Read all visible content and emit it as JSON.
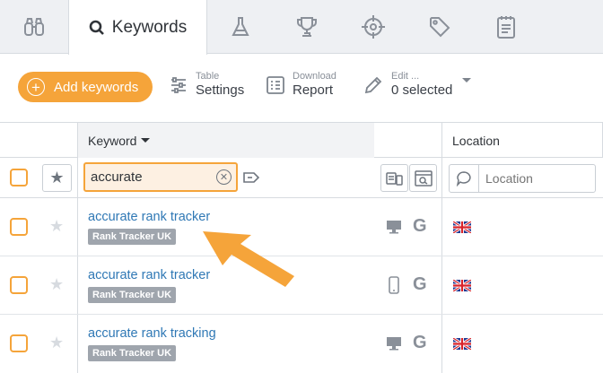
{
  "tabs": {
    "active_label": "Keywords"
  },
  "toolbar": {
    "add_label": "Add keywords",
    "table_small": "Table",
    "table_big": "Settings",
    "download_small": "Download",
    "download_big": "Report",
    "edit_small": "Edit ...",
    "edit_big": "0 selected"
  },
  "columns": {
    "keyword": "Keyword",
    "location": "Location"
  },
  "filters": {
    "search_value": "accurate",
    "location_placeholder": "Location"
  },
  "rows": [
    {
      "keyword": "accurate rank tracker",
      "project": "Rank Tracker UK",
      "device": "desktop",
      "engine": "G"
    },
    {
      "keyword": "accurate rank tracker",
      "project": "Rank Tracker UK",
      "device": "mobile",
      "engine": "G"
    },
    {
      "keyword": "accurate rank tracking",
      "project": "Rank Tracker UK",
      "device": "desktop",
      "engine": "G"
    }
  ],
  "colors": {
    "accent": "#f5a43a",
    "link": "#2f78b5",
    "badge": "#9fa5ad"
  }
}
